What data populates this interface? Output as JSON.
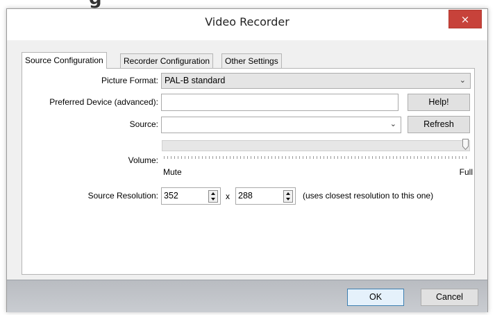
{
  "background": {
    "heading_fragment": "g"
  },
  "window": {
    "title": "Video Recorder",
    "close_label": "×"
  },
  "tabs": [
    {
      "label": "Source Configuration",
      "active": true
    },
    {
      "label": "Recorder Configuration",
      "active": false
    },
    {
      "label": "Other Settings",
      "active": false
    }
  ],
  "form": {
    "picture_format": {
      "label": "Picture Format:",
      "value": "PAL-B standard"
    },
    "preferred_device": {
      "label": "Preferred Device (advanced):",
      "value": "",
      "help_button": "Help!"
    },
    "source": {
      "label": "Source:",
      "value": "",
      "refresh_button": "Refresh"
    },
    "volume": {
      "label": "Volume:",
      "min_label": "Mute",
      "max_label": "Full",
      "level": 1.0
    },
    "source_resolution": {
      "label": "Source Resolution:",
      "width": "352",
      "separator": "x",
      "height": "288",
      "note": "(uses closest resolution to this one)"
    }
  },
  "buttons": {
    "ok": "OK",
    "cancel": "Cancel"
  },
  "colors": {
    "close": "#c7423a",
    "client": "#f0f0f0",
    "bottom_bar": "#c0c3c8"
  }
}
